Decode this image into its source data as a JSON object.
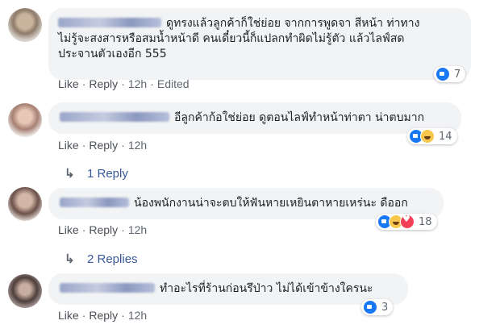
{
  "comments": [
    {
      "text": "ดูทรงแล้วลูกค้าก็ใช่ย่อย จากการพูดจา สีหน้า ท่าทาง\nไม่รู้จะสงสารหรือสมน้ำหน้าดี คนเดี๋ยวนี้ก็แปลกทำผิดไม่รู้ตัว แล้วไลฟ์สด\nประจานตัวเองอีก 555",
      "actions": {
        "like": "Like",
        "reply": "Reply",
        "time": "12h",
        "edited": "Edited"
      },
      "reaction_types": [
        "like"
      ],
      "reaction_count": "7"
    },
    {
      "text": "อีลูกค้าก้อใช่ย่อย ดูตอนไลฟ์ทำหน้าท่าตา น่าตบมาก",
      "actions": {
        "like": "Like",
        "reply": "Reply",
        "time": "12h"
      },
      "reaction_types": [
        "like",
        "haha"
      ],
      "reaction_count": "14",
      "replies_label": "1 Reply"
    },
    {
      "text": "น้องพนักงานน่าจะตบให้ฟันหายเหยินตาหายเหร่นะ ดืออก",
      "actions": {
        "like": "Like",
        "reply": "Reply",
        "time": "12h"
      },
      "reaction_types": [
        "like",
        "haha",
        "love"
      ],
      "reaction_count": "18",
      "replies_label": "2 Replies"
    },
    {
      "text": "ทำอะไรที่ร้านก่อนรึป่าว ไม่ได้เข้าข้างใครนะ",
      "actions": {
        "like": "Like",
        "reply": "Reply",
        "time": "12h"
      },
      "reaction_types": [
        "like"
      ],
      "reaction_count": "3"
    }
  ],
  "colors": {
    "bubble": "#f2f3f5",
    "link": "#385898",
    "like_blue": "#1877f2",
    "meta_gray": "#606770"
  }
}
